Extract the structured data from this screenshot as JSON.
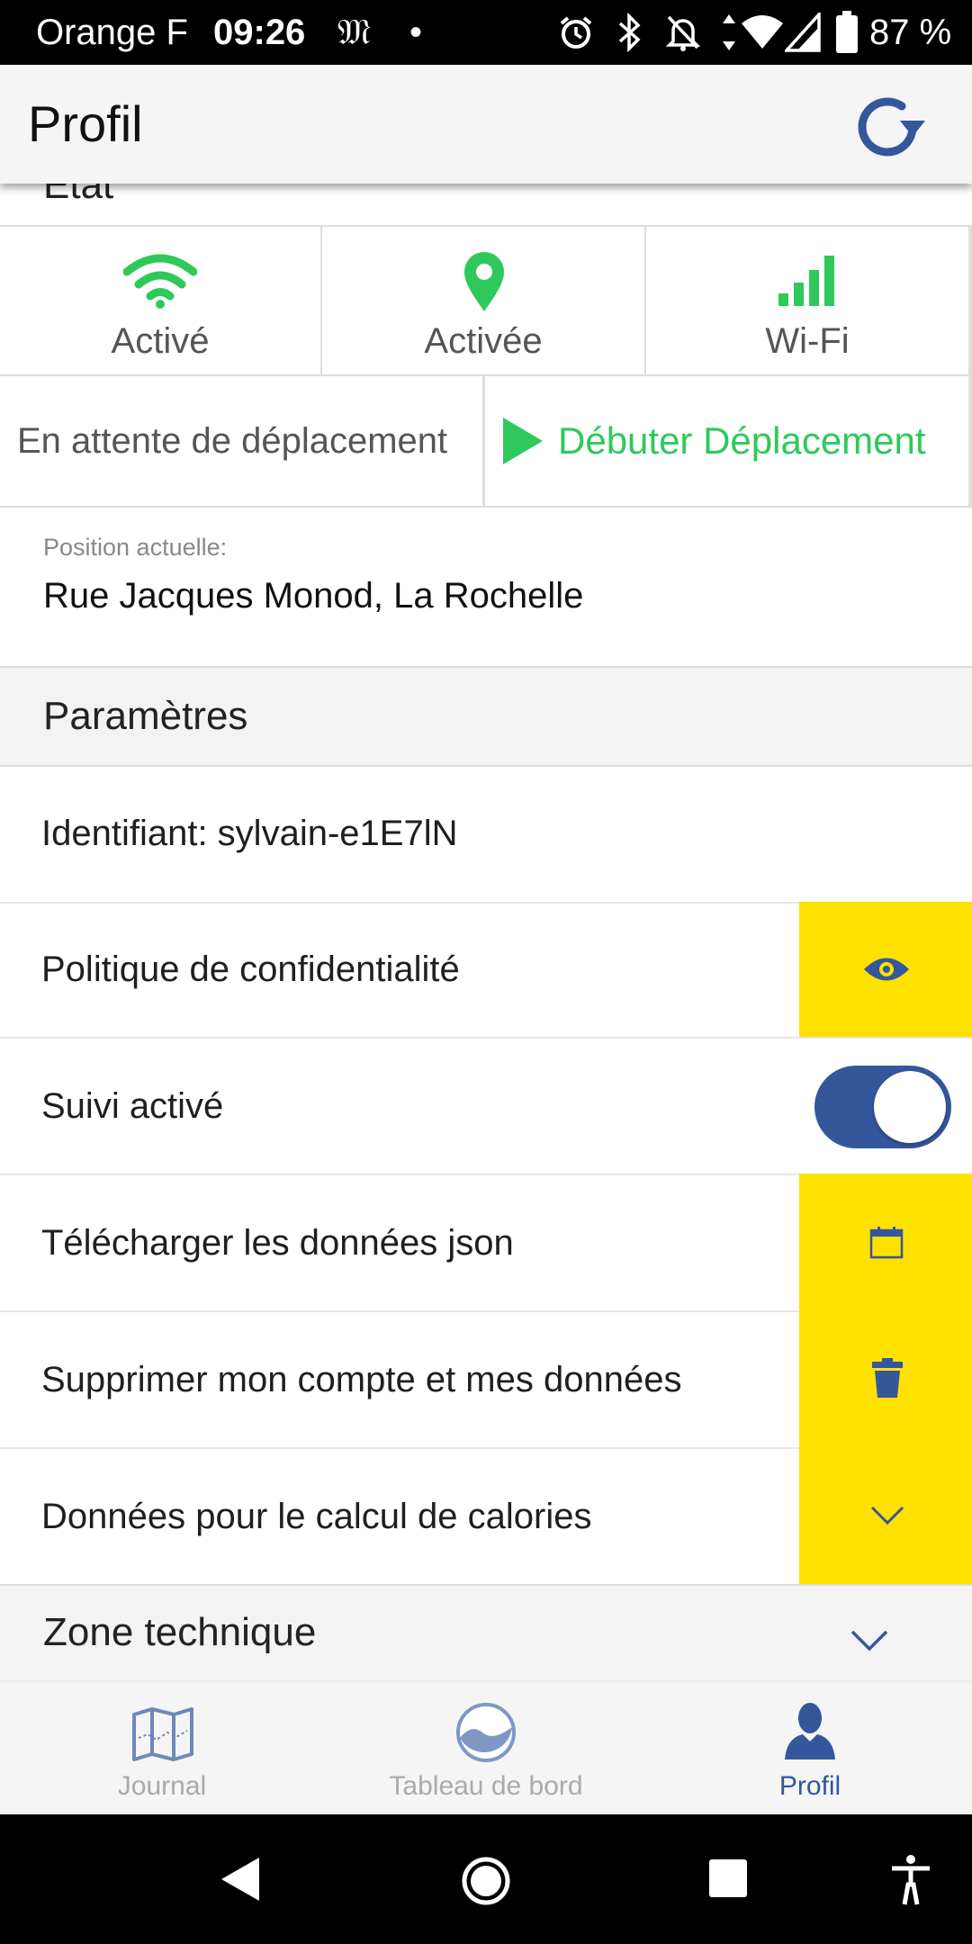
{
  "status_bar": {
    "carrier": "Orange F",
    "time": "09:26",
    "app_glyph": "𝔐",
    "dot": "•",
    "battery": "87 %"
  },
  "header": {
    "title": "Profil",
    "refresh_icon": "refresh-icon"
  },
  "etat": {
    "partial_section_title": "État",
    "cells": [
      {
        "icon": "wifi-icon",
        "label": "Activé"
      },
      {
        "icon": "location-pin-icon",
        "label": "Activée"
      },
      {
        "icon": "signal-bars-icon",
        "label": "Wi-Fi"
      }
    ],
    "waiting_text": "En attente de déplacement",
    "start_button_label": "Débuter Déplacement",
    "position_label": "Position actuelle:",
    "position_value": "Rue Jacques Monod, La Rochelle"
  },
  "colors": {
    "accent_blue": "#34579c",
    "green": "#2ec95a",
    "yellow": "#ffe100"
  },
  "parametres": {
    "title": "Paramètres",
    "identifier": "Identifiant: sylvain-e1E7lN",
    "privacy_label": "Politique de confidentialité",
    "tracking_label": "Suivi activé",
    "tracking_enabled": true,
    "download_label": "Télécharger les données json",
    "delete_label": "Supprimer mon compte et mes données",
    "calories_label": "Données pour le calcul de calories"
  },
  "zone_technique": {
    "title": "Zone technique"
  },
  "bottom_nav": {
    "items": [
      {
        "icon": "map-icon",
        "label": "Journal",
        "active": false
      },
      {
        "icon": "dashboard-icon",
        "label": "Tableau de bord",
        "active": false
      },
      {
        "icon": "user-icon",
        "label": "Profil",
        "active": true
      }
    ]
  }
}
